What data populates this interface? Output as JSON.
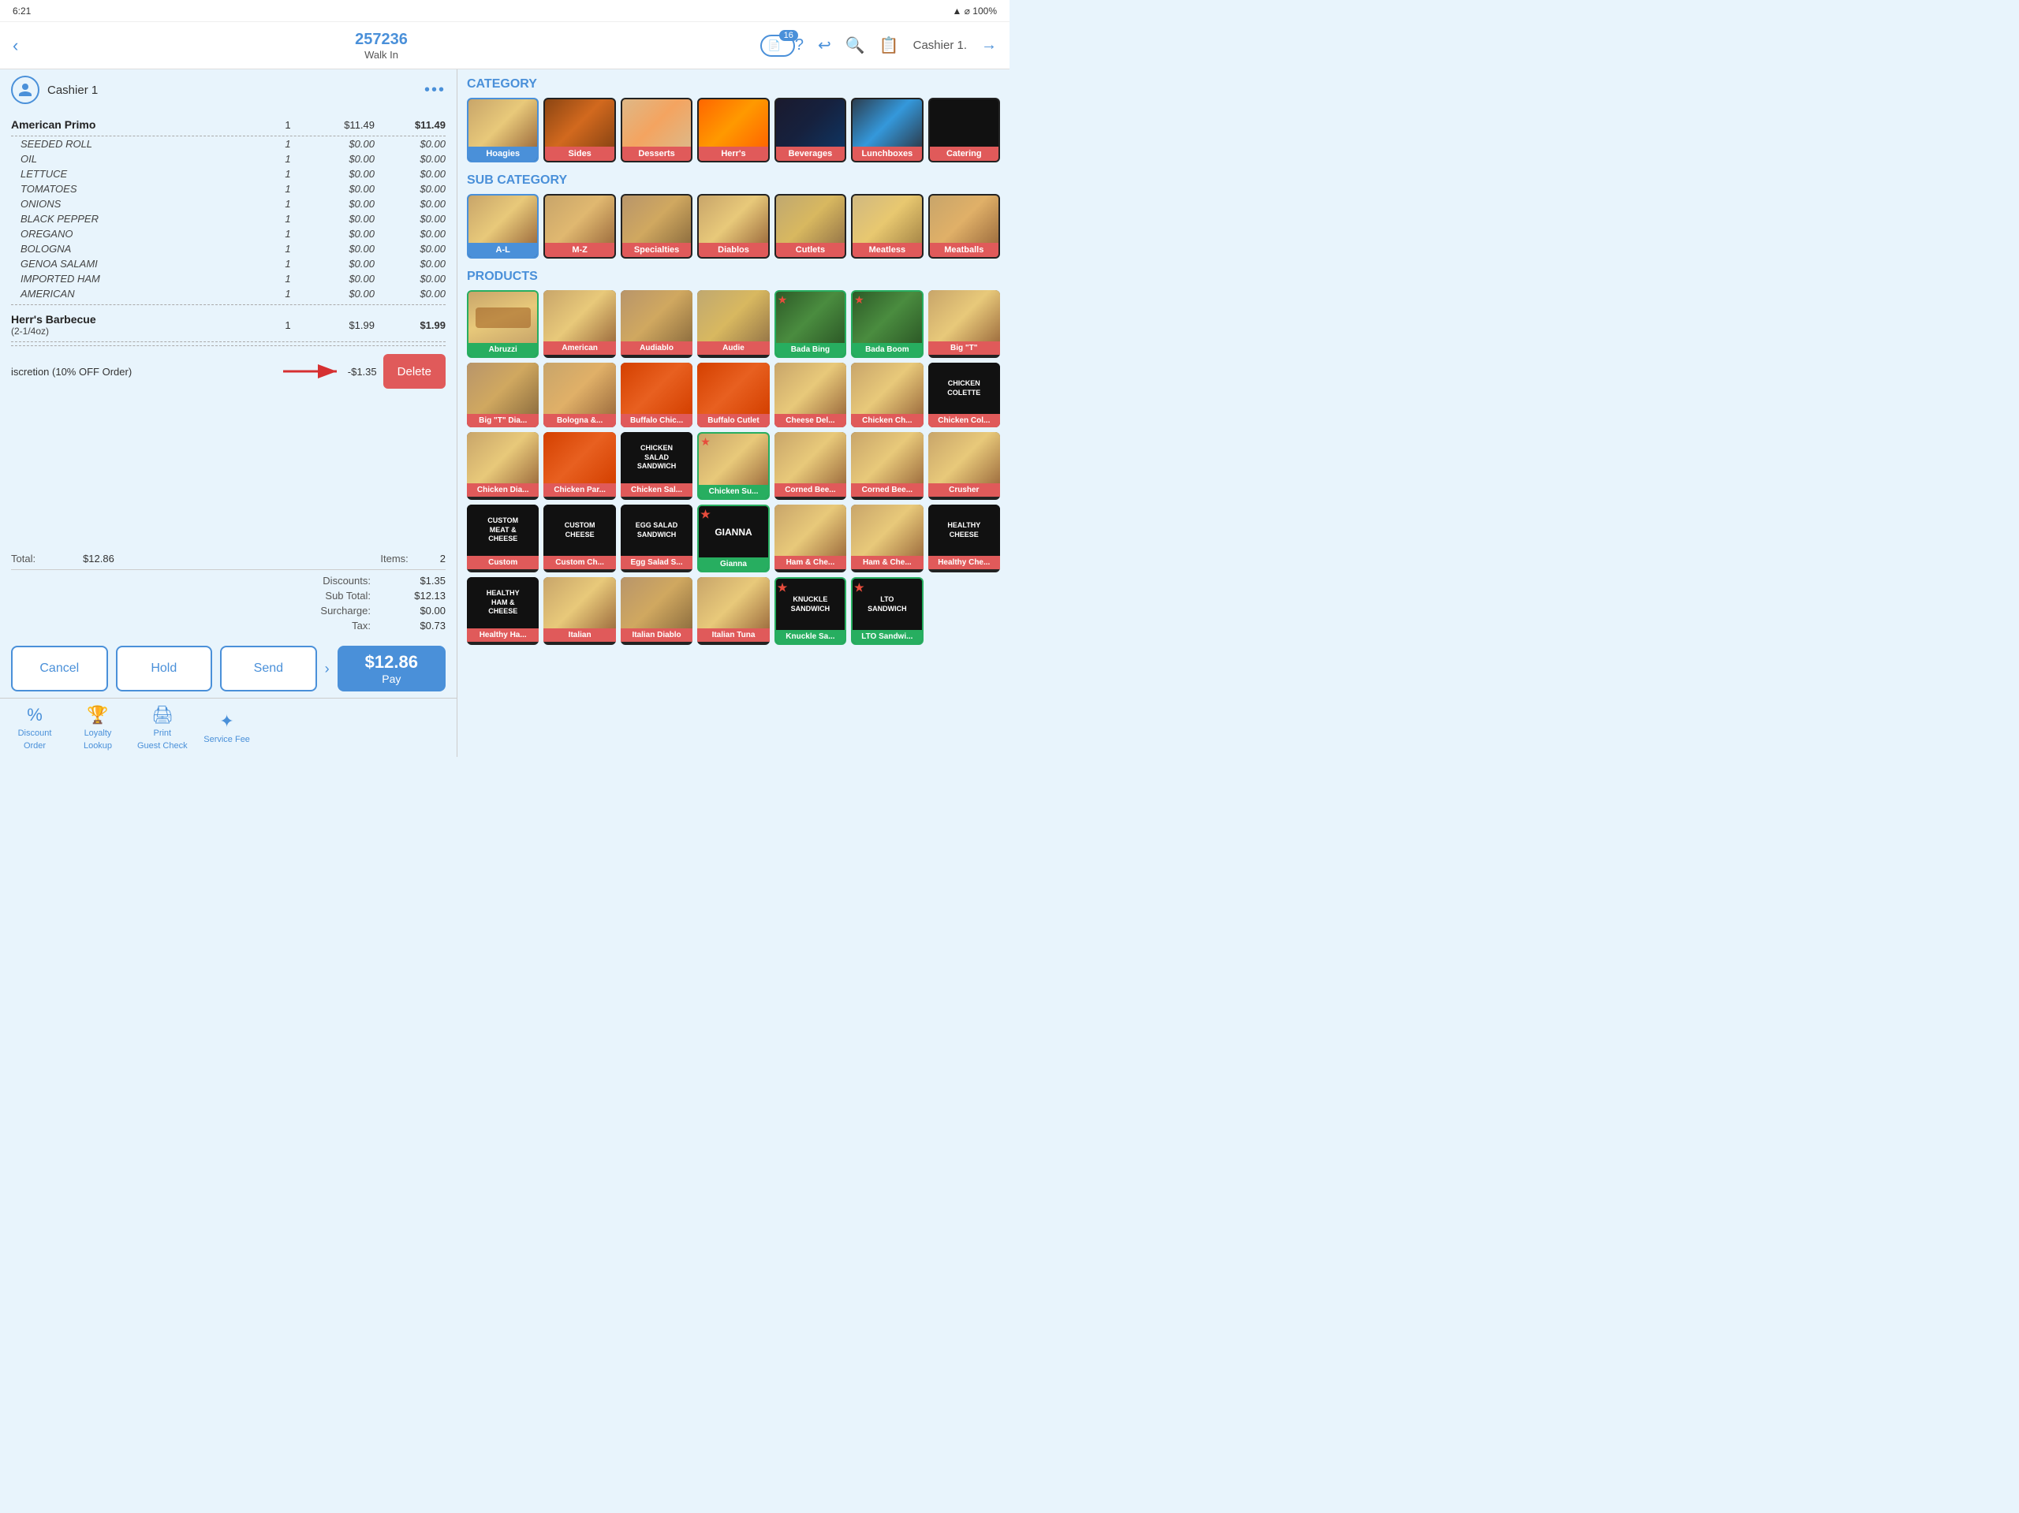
{
  "statusBar": {
    "time": "6:21",
    "battery": "100%"
  },
  "header": {
    "backLabel": "‹",
    "orderNumber": "257236",
    "orderType": "Walk In",
    "badgeCount": "16",
    "helpIcon": "?",
    "undoIcon": "↩",
    "searchIcon": "🔍",
    "copyIcon": "📋",
    "cashierLabel": "Cashier 1.",
    "logoutIcon": "→"
  },
  "leftPanel": {
    "cashierName": "Cashier 1",
    "moreDotsLabel": "•••",
    "orderItems": [
      {
        "name": "American Primo",
        "qty": "1",
        "price": "$11.49",
        "total": "$11.49",
        "modifiers": [
          {
            "name": "SEEDED ROLL",
            "qty": "1",
            "price": "$0.00"
          },
          {
            "name": "OIL",
            "qty": "1",
            "price": "$0.00"
          },
          {
            "name": "LETTUCE",
            "qty": "1",
            "price": "$0.00"
          },
          {
            "name": "TOMATOES",
            "qty": "1",
            "price": "$0.00"
          },
          {
            "name": "ONIONS",
            "qty": "1",
            "price": "$0.00"
          },
          {
            "name": "BLACK PEPPER",
            "qty": "1",
            "price": "$0.00"
          },
          {
            "name": "OREGANO",
            "qty": "1",
            "price": "$0.00"
          },
          {
            "name": "BOLOGNA",
            "qty": "1",
            "price": "$0.00"
          },
          {
            "name": "GENOA SALAMI",
            "qty": "1",
            "price": "$0.00"
          },
          {
            "name": "IMPORTED HAM",
            "qty": "1",
            "price": "$0.00"
          },
          {
            "name": "AMERICAN",
            "qty": "1",
            "price": "$0.00"
          }
        ]
      },
      {
        "name": "Herr's Barbecue",
        "nameExtra": "(2-1/4oz)",
        "qty": "1",
        "price": "$1.99",
        "total": "$1.99",
        "modifiers": []
      }
    ],
    "discountRow": {
      "label": "iscretion (10% OFF Order)",
      "amount": "-$1.35",
      "deleteLabel": "Delete"
    },
    "totals": {
      "discountsLabel": "Discounts:",
      "discountsValue": "$1.35",
      "subTotalLabel": "Sub Total:",
      "subTotalValue": "$12.13",
      "surchargeLabel": "Surcharge:",
      "surchargeValue": "$0.00",
      "taxLabel": "Tax:",
      "taxValue": "$0.73"
    },
    "actionButtons": {
      "cancelLabel": "Cancel",
      "holdLabel": "Hold",
      "sendLabel": "Send",
      "totalLabel": "$12.86",
      "payLabel": "Pay"
    },
    "totalItems": {
      "totalLabel": "Total:",
      "totalValue": "$12.86",
      "itemsLabel": "Items:",
      "itemsValue": "2"
    },
    "bottomBar": [
      {
        "icon": "%",
        "label": "Discount\nOrder"
      },
      {
        "icon": "🏆",
        "label": "Loyalty\nLookup"
      },
      {
        "icon": "🖨",
        "label": "Print\nGuest Check"
      },
      {
        "icon": "✦",
        "label": "Service Fee"
      }
    ]
  },
  "rightPanel": {
    "categoryTitle": "CATEGORY",
    "categories": [
      {
        "label": "Hoagies",
        "active": true
      },
      {
        "label": "Sides"
      },
      {
        "label": "Desserts"
      },
      {
        "label": "Herr's"
      },
      {
        "label": "Beverages"
      },
      {
        "label": "Lunchboxes"
      },
      {
        "label": "Catering"
      }
    ],
    "subCategoryTitle": "SUB CATEGORY",
    "subCategories": [
      {
        "label": "A-L",
        "active": true
      },
      {
        "label": "M-Z"
      },
      {
        "label": "Specialties"
      },
      {
        "label": "Diablos"
      },
      {
        "label": "Cutlets"
      },
      {
        "label": "Meatless"
      },
      {
        "label": "Meatballs"
      }
    ],
    "productsTitle": "PRODUCTS",
    "products": [
      {
        "label": "Abruzzi",
        "border": "green",
        "hasStar": false
      },
      {
        "label": "American",
        "border": "none",
        "hasStar": false
      },
      {
        "label": "Audiablo",
        "border": "none",
        "hasStar": false
      },
      {
        "label": "Audie",
        "border": "none",
        "hasStar": false
      },
      {
        "label": "Bada Bing",
        "border": "green",
        "hasStar": true
      },
      {
        "label": "Bada Boom",
        "border": "green",
        "hasStar": true
      },
      {
        "label": "Big \"T\"",
        "border": "none",
        "hasStar": false
      },
      {
        "label": "Big \"T\" Dia...",
        "border": "none",
        "hasStar": false
      },
      {
        "label": "Bologna &...",
        "border": "none",
        "hasStar": false
      },
      {
        "label": "Buffalo Chic...",
        "border": "none",
        "hasStar": false
      },
      {
        "label": "Buffalo Cutlet",
        "border": "none",
        "hasStar": false
      },
      {
        "label": "Cheese Del...",
        "border": "none",
        "hasStar": false
      },
      {
        "label": "Chicken Ch...",
        "border": "none",
        "hasStar": false
      },
      {
        "label": "Chicken Col...",
        "border": "none",
        "hasStar": false,
        "textOnly": true,
        "textContent": "CHICKEN\nCOLETTE"
      },
      {
        "label": "Chicken Dia...",
        "border": "none",
        "hasStar": false
      },
      {
        "label": "Chicken Par...",
        "border": "none",
        "hasStar": false
      },
      {
        "label": "Chicken Sal...",
        "border": "none",
        "hasStar": false,
        "textOnly": true,
        "textContent": "CHICKEN\nSALAD\nSANDWICH"
      },
      {
        "label": "Chicken Su...",
        "border": "green",
        "hasStar": true
      },
      {
        "label": "Corned Bee...",
        "border": "none",
        "hasStar": false
      },
      {
        "label": "Corned Bee...",
        "border": "none",
        "hasStar": false
      },
      {
        "label": "Crusher",
        "border": "none",
        "hasStar": false
      },
      {
        "label": "Custom",
        "border": "none",
        "hasStar": false,
        "textOnly": true,
        "textContent": "CUSTOM\nMEAT &\nCHEESE"
      },
      {
        "label": "Custom Ch...",
        "border": "none",
        "hasStar": false,
        "textOnly": true,
        "textContent": "CUSTOM\nCHEESE"
      },
      {
        "label": "Egg Salad S...",
        "border": "none",
        "hasStar": false,
        "textOnly": true,
        "textContent": "EGG SALAD\nSANDWICH"
      },
      {
        "label": "Gianna",
        "border": "green",
        "hasStar": true,
        "textOnly": true,
        "textContent": "GIANNA"
      },
      {
        "label": "Ham & Che...",
        "border": "none",
        "hasStar": false
      },
      {
        "label": "Ham & Che...",
        "border": "none",
        "hasStar": false
      },
      {
        "label": "Healthy Che...",
        "border": "none",
        "hasStar": false,
        "textOnly": true,
        "textContent": "HEALTHY\nCHEESE"
      },
      {
        "label": "Healthy Ha...",
        "border": "none",
        "hasStar": false,
        "textOnly": true,
        "textContent": "HEALTHY\nHAM &\nCHEESE"
      },
      {
        "label": "Italian",
        "border": "none",
        "hasStar": false
      },
      {
        "label": "Italian Diablo",
        "border": "none",
        "hasStar": false
      },
      {
        "label": "Italian Tuna",
        "border": "none",
        "hasStar": false
      },
      {
        "label": "Knuckle Sa...",
        "border": "green",
        "hasStar": true,
        "textOnly": true,
        "textContent": "KNUCKLE\nSANDWICH"
      },
      {
        "label": "LTO Sandwi...",
        "border": "green",
        "hasStar": true,
        "textOnly": true,
        "textContent": "LTO\nSANDWICH"
      }
    ]
  }
}
